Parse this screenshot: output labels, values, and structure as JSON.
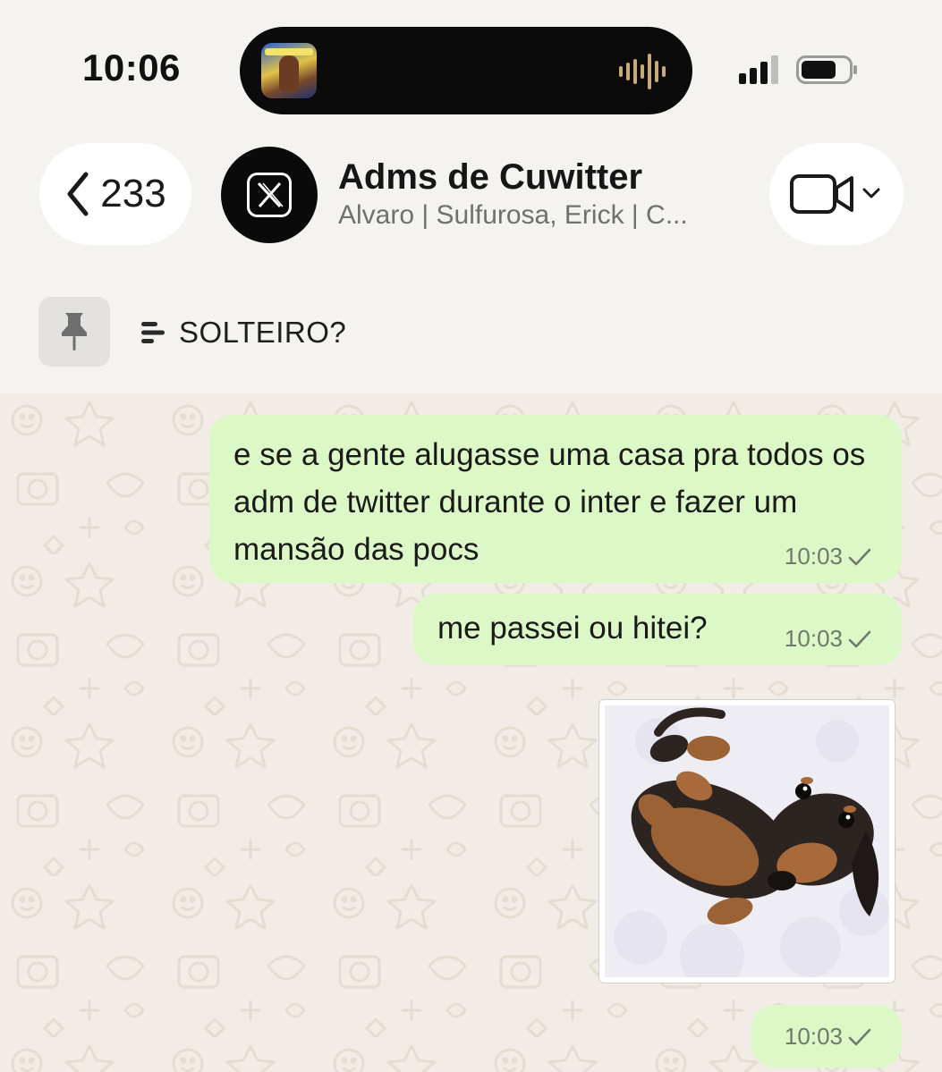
{
  "status_bar": {
    "time": "10:06"
  },
  "header": {
    "back_count": "233",
    "group_name": "Adms de Cuwitter",
    "group_members": "Alvaro | Sulfurosa, Erick | C..."
  },
  "pinned": {
    "text": "SOLTEIRO?"
  },
  "messages": [
    {
      "type": "text",
      "text": "e se a gente alugasse uma casa pra todos os adm de twitter durante o inter e fazer um mansão das pocs",
      "time": "10:03"
    },
    {
      "type": "text",
      "text": "me passei ou hitei?",
      "time": "10:03"
    },
    {
      "type": "sticker",
      "depicts": "dachshund puppy lying on its back",
      "time": "10:03"
    }
  ],
  "icons": {
    "back": "chevron-left-icon",
    "avatar": "x-logo-icon",
    "video": "video-camera-icon",
    "pin": "pin-icon",
    "poll": "poll-icon",
    "tick": "checkmark-icon"
  },
  "colors": {
    "outgoing_bubble": "#dbf8c6",
    "chat_background": "#f1ede6",
    "header_background": "#f5f3f0"
  }
}
